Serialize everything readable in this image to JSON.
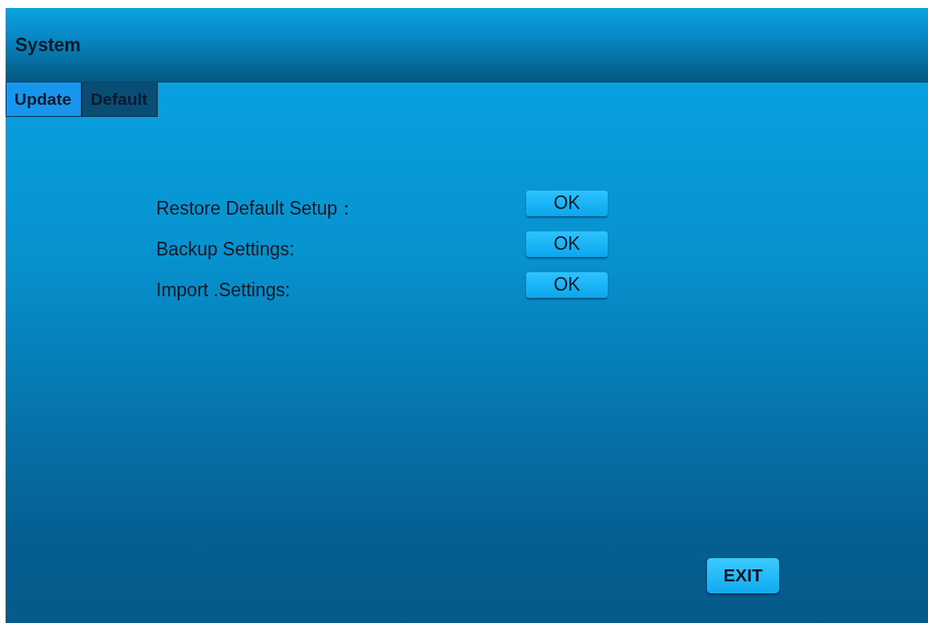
{
  "window": {
    "title": "System"
  },
  "tabs": [
    {
      "label": "Update",
      "selected": true
    },
    {
      "label": "Default",
      "selected": false
    }
  ],
  "settings": [
    {
      "label": "Restore Default Setup：",
      "button": "OK"
    },
    {
      "label": "Backup Settings:",
      "button": "OK"
    },
    {
      "label": "Import .Settings:",
      "button": "OK"
    }
  ],
  "exit_button": "EXIT"
}
